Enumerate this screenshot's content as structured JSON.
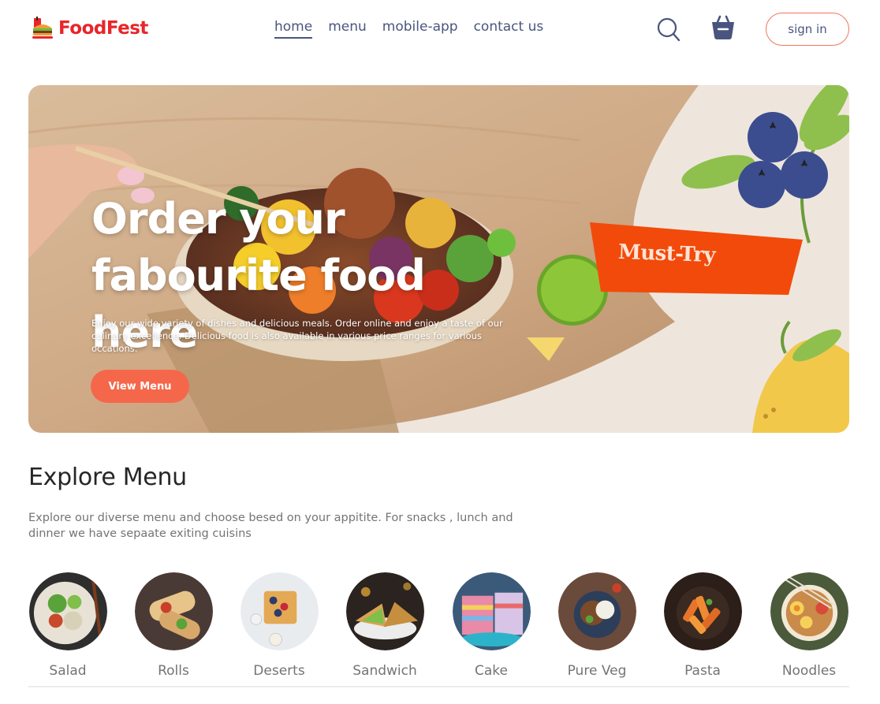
{
  "navbar": {
    "logo_text": "FoodFest",
    "links": [
      {
        "label": "home",
        "active": true
      },
      {
        "label": "menu",
        "active": false
      },
      {
        "label": "mobile-app",
        "active": false
      },
      {
        "label": "contact us",
        "active": false
      }
    ],
    "search_icon": "search-icon",
    "basket_icon": "basket-icon",
    "signin_label": "sign in"
  },
  "hero": {
    "title_line1": "Order your",
    "title_line2": "fabourite food here",
    "description": "Enjoy our wide variety of dishes and delicious meals. Order online and enjoy a taste of our culinary excellence. Delicious food is also available in various price ranges for various occations.",
    "cta_label": "View Menu",
    "badge_label": "Must-Try"
  },
  "explore": {
    "title": "Explore Menu",
    "description": "Explore our diverse menu and choose besed on your appitite. For snacks , lunch and dinner we have sepaate exiting cuisins",
    "items": [
      {
        "label": "Salad"
      },
      {
        "label": "Rolls"
      },
      {
        "label": "Deserts"
      },
      {
        "label": "Sandwich"
      },
      {
        "label": "Cake"
      },
      {
        "label": "Pure Veg"
      },
      {
        "label": "Pasta"
      },
      {
        "label": "Noodles"
      }
    ]
  },
  "colors": {
    "brand_red": "#e8252a",
    "accent_orange": "#f5674b",
    "nav_text": "#49557e",
    "muted_text": "#747474"
  }
}
